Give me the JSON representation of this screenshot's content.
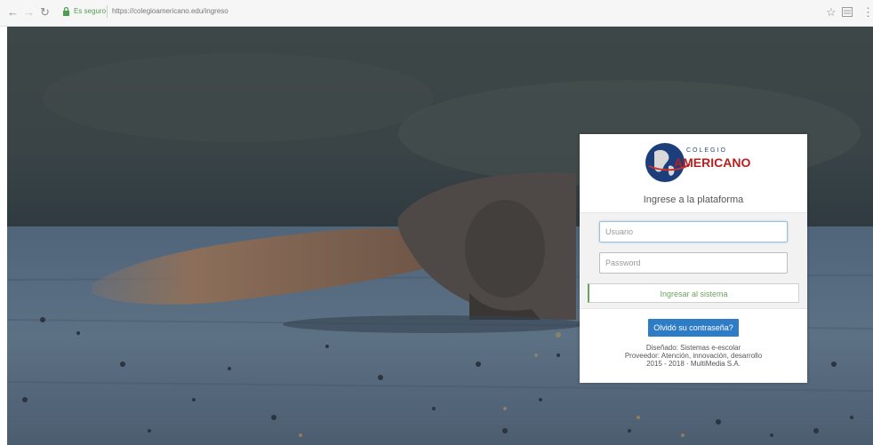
{
  "browser": {
    "back_icon": "arrow-left-icon",
    "forward_icon": "arrow-right-icon",
    "reload_icon": "reload-icon",
    "secure_label": "Es seguro",
    "url": "https://colegioamericano.edu/ingreso",
    "star_icon": "star-icon",
    "menu_icon": "kebab-menu-icon"
  },
  "login": {
    "logo_top": "COLEGIO",
    "logo_main": "AMERICANO",
    "title": "Ingrese a la plataforma",
    "username_placeholder": "Usuario",
    "password_placeholder": "Password",
    "enter_label": "Ingresar al sistema",
    "forgot_label": "Olvidó su contraseña?",
    "footer_line1": "Diseñado: Sistemas e-escolar",
    "footer_line2": "Proveedor: Atención, innovación, desarrollo",
    "footer_line3": "2015 - 2018 · MultiMedia S.A.",
    "accent_blue": "#2f7cc6",
    "accent_green": "#6aa45b"
  }
}
